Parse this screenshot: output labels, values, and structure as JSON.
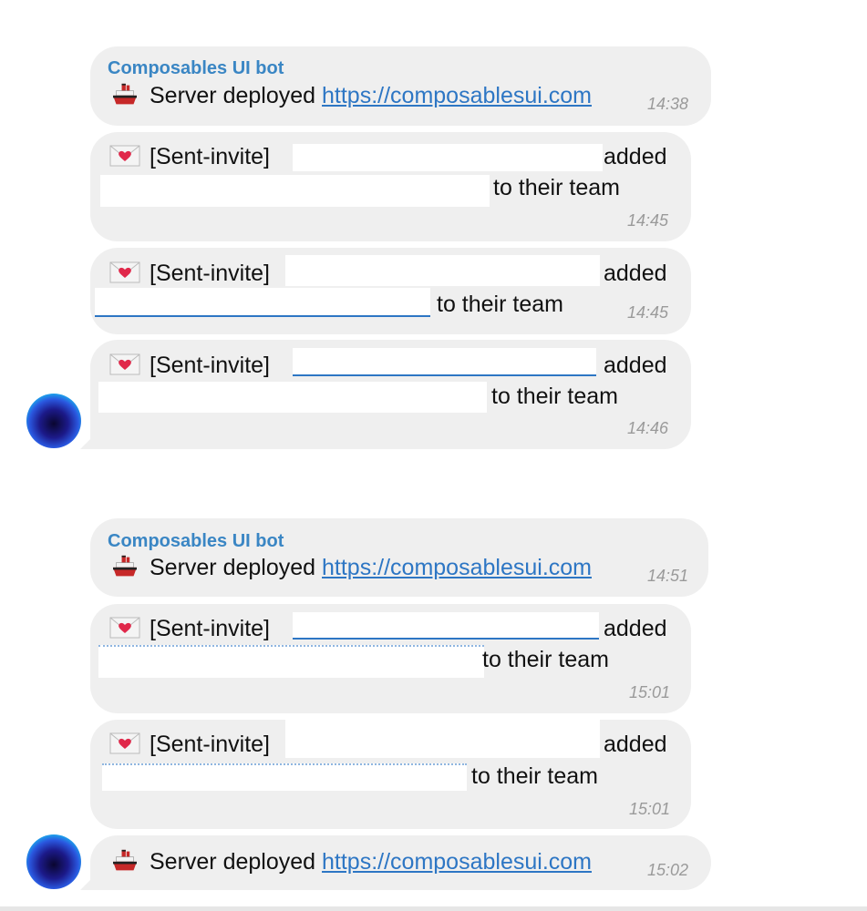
{
  "messages": [
    {
      "sender": "Composables UI bot",
      "type": "deploy",
      "text": "Server deployed",
      "link": "https://composablesui.com",
      "time": "14:38"
    },
    {
      "type": "invite",
      "prefix": "[Sent-invite]",
      "suffix": "added",
      "line2": "to their team",
      "time": "14:45"
    },
    {
      "type": "invite",
      "prefix": "[Sent-invite]",
      "suffix": "added",
      "line2": "to their team",
      "time": "14:45"
    },
    {
      "type": "invite",
      "prefix": "[Sent-invite]",
      "suffix": "added",
      "line2": "to their team",
      "time": "14:46"
    },
    {
      "sender": "Composables UI bot",
      "type": "deploy",
      "text": "Server deployed",
      "link": "https://composablesui.com",
      "time": "14:51"
    },
    {
      "type": "invite",
      "prefix": "[Sent-invite]",
      "suffix": "added",
      "line2": "to their team",
      "time": "15:01"
    },
    {
      "type": "invite",
      "prefix": "[Sent-invite]",
      "suffix": "added",
      "line2": "to their team",
      "time": "15:01"
    },
    {
      "type": "deploy",
      "text": "Server deployed",
      "link": "https://composablesui.com",
      "time": "15:02"
    }
  ],
  "icons": {
    "deploy": "ship-icon",
    "invite": "love-letter-icon",
    "avatar": "bot-avatar"
  }
}
